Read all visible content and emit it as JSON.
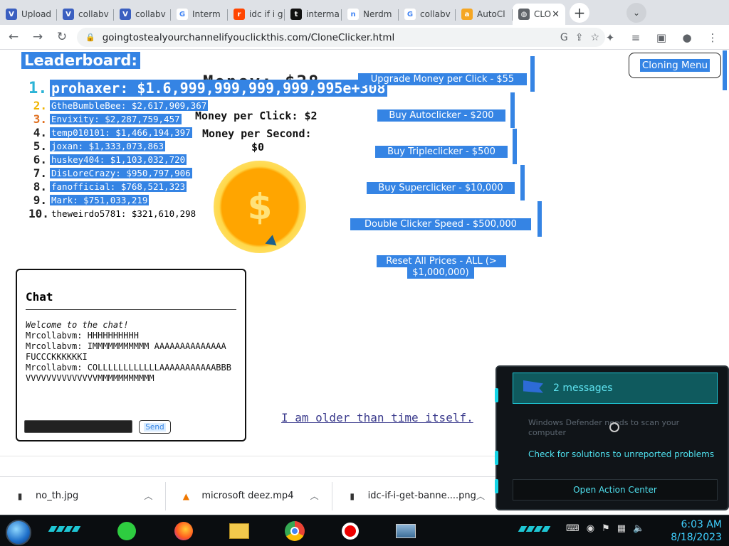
{
  "tabs": [
    {
      "label": "Upload",
      "icon": "V",
      "color": "#3b5fc0"
    },
    {
      "label": "collabv",
      "icon": "V",
      "color": "#3b5fc0"
    },
    {
      "label": "collabv",
      "icon": "V",
      "color": "#3b5fc0"
    },
    {
      "label": "Interm",
      "icon": "G",
      "color": "#ffffff"
    },
    {
      "label": "idc if i g",
      "icon": "r",
      "color": "#ff4500"
    },
    {
      "label": "interma",
      "icon": "t",
      "color": "#111111"
    },
    {
      "label": "Nerdm",
      "icon": "n",
      "color": "#ffffff"
    },
    {
      "label": "collabv",
      "icon": "G",
      "color": "#ffffff"
    },
    {
      "label": "AutoCl",
      "icon": "a",
      "color": "#f5a623"
    }
  ],
  "active_tab": {
    "label": "CLO",
    "close": "✕"
  },
  "new_tab": "+",
  "url": "goingtostealyourchannelifyouclickthis.com/CloneClicker.html",
  "leaderboard": {
    "title": "Leaderboard:",
    "entries": [
      {
        "rank": "1.",
        "text": "prohaxer: $1.6,999,999,999,999,995e+308",
        "rank_color": "#2bb3d6"
      },
      {
        "rank": "2.",
        "text": "GtheBumbleBee: $2,617,909,367",
        "rank_color": "#f0b400"
      },
      {
        "rank": "3.",
        "text": "Envixity: $2,287,759,457",
        "rank_color": "#e07020"
      },
      {
        "rank": "4.",
        "text": "temp010101: $1,466,194,397",
        "rank_color": "#222222"
      },
      {
        "rank": "5.",
        "text": "joxan: $1,333,073,863",
        "rank_color": "#222222"
      },
      {
        "rank": "6.",
        "text": "huskey404: $1,103,032,720",
        "rank_color": "#222222"
      },
      {
        "rank": "7.",
        "text": "DisLoreCrazy: $950,797,906",
        "rank_color": "#222222"
      },
      {
        "rank": "8.",
        "text": "fanofficial: $768,521,323",
        "rank_color": "#222222"
      },
      {
        "rank": "9.",
        "text": "Mark: $751,033,219",
        "rank_color": "#222222"
      },
      {
        "rank": "10.",
        "text": "theweirdo5781: $321,610,298",
        "rank_color": "#222222"
      }
    ]
  },
  "stats": {
    "money_ghost": "Money: $28",
    "per_click": "Money per Click: $2",
    "per_second_label": "Money per Second:",
    "per_second_value": "$0"
  },
  "coin_symbol": "$",
  "shop": {
    "upgrade": "Upgrade Money per Click - $55",
    "autoclicker": "Buy Autoclicker - $200",
    "tripleclicker": "Buy Tripleclicker - $500",
    "superclicker": "Buy Superclicker - $10,000",
    "double_speed": "Double Clicker Speed - $500,000",
    "reset_line1": "Reset All Prices - ALL (>",
    "reset_line2": "$1,000,000)"
  },
  "cloning_menu": "Cloning Menu",
  "chat": {
    "title": "Chat",
    "welcome": "Welcome to the chat!",
    "messages": [
      "Mrcollabvm: HHHHHHHHHH",
      "Mrcollabvm: IMMMMMMMMMMM AAAAAAAAAAAAAA FUCCCKKKKKKI",
      "Mrcollabvm: COLLLLLLLLLLLLAAAAAAAAAAABBBVVVVVVVVVVVVVVMMMMMMMMMMM"
    ],
    "send": "Send"
  },
  "footer_link": "I am older than time itself.",
  "downloads": [
    {
      "name": "no_th.jpg",
      "icon": "▮"
    },
    {
      "name": "microsoft deez.mp4",
      "icon": "▲"
    },
    {
      "name": "idc-if-i-get-banne....png",
      "icon": "▮"
    }
  ],
  "notification": {
    "header": "2 messages",
    "body": "Windows Defender needs to scan your computer",
    "link": "Check for solutions to unreported problems",
    "action": "Open Action Center"
  },
  "clock": {
    "time": "6:03 AM",
    "date": "8/18/2023"
  }
}
